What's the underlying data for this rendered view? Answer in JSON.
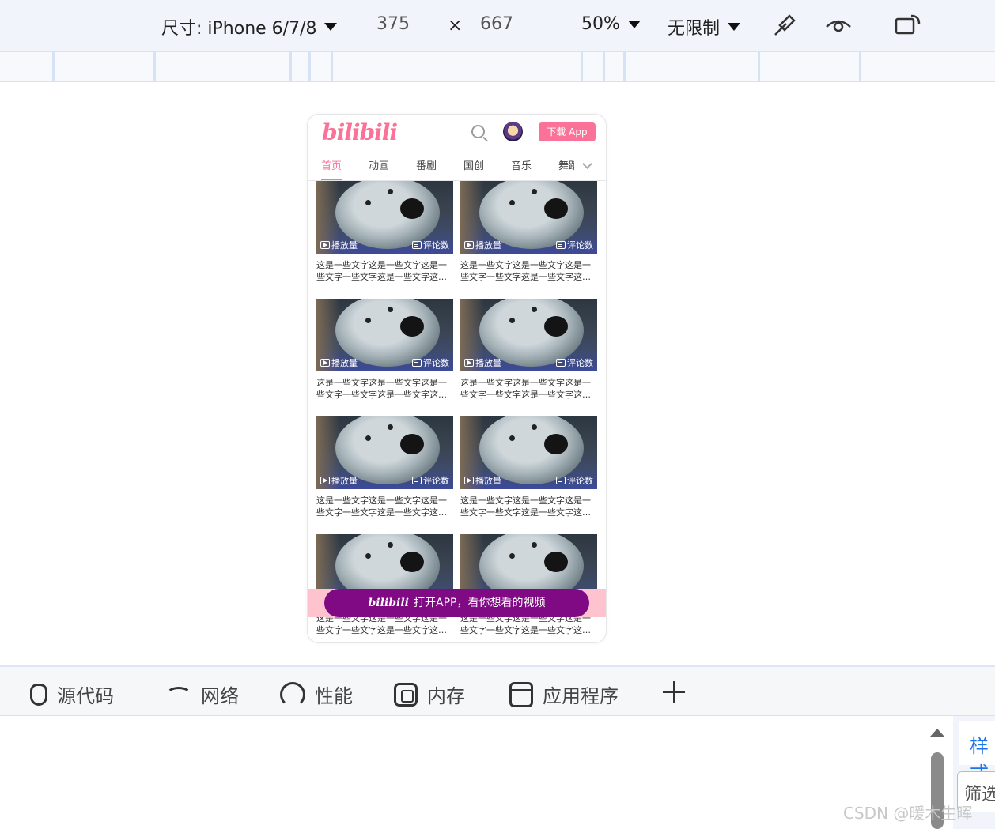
{
  "toolbar": {
    "device_label": "尺寸: iPhone 6/7/8",
    "width": "375",
    "times": "×",
    "height": "667",
    "zoom": "50%",
    "throttle": "无限制"
  },
  "phone": {
    "logo": "bilibili",
    "download_label": "下载 App",
    "tabs": [
      "首页",
      "动画",
      "番剧",
      "国创",
      "音乐",
      "舞蹈"
    ],
    "active_tab": 0,
    "card_play_label": "播放量",
    "card_comment_label": "评论数",
    "card_title": "这是一些文字这是一些文字这是一些文字一些文字这是一些文字这是一些文字",
    "banner_logo": "bilibili",
    "banner_text": "打开APP，看你想看的视频",
    "colors": {
      "brand_pink": "#fb7299",
      "banner_purple": "#7f0a84",
      "banner_bg": "#ffc3cf"
    }
  },
  "devtools_tabs": [
    "源代码",
    "网络",
    "性能",
    "内存",
    "应用程序"
  ],
  "right_panel": {
    "styles_tab": "样式",
    "filter_placeholder": "筛选"
  },
  "watermark": "CSDN @暖木生晖"
}
